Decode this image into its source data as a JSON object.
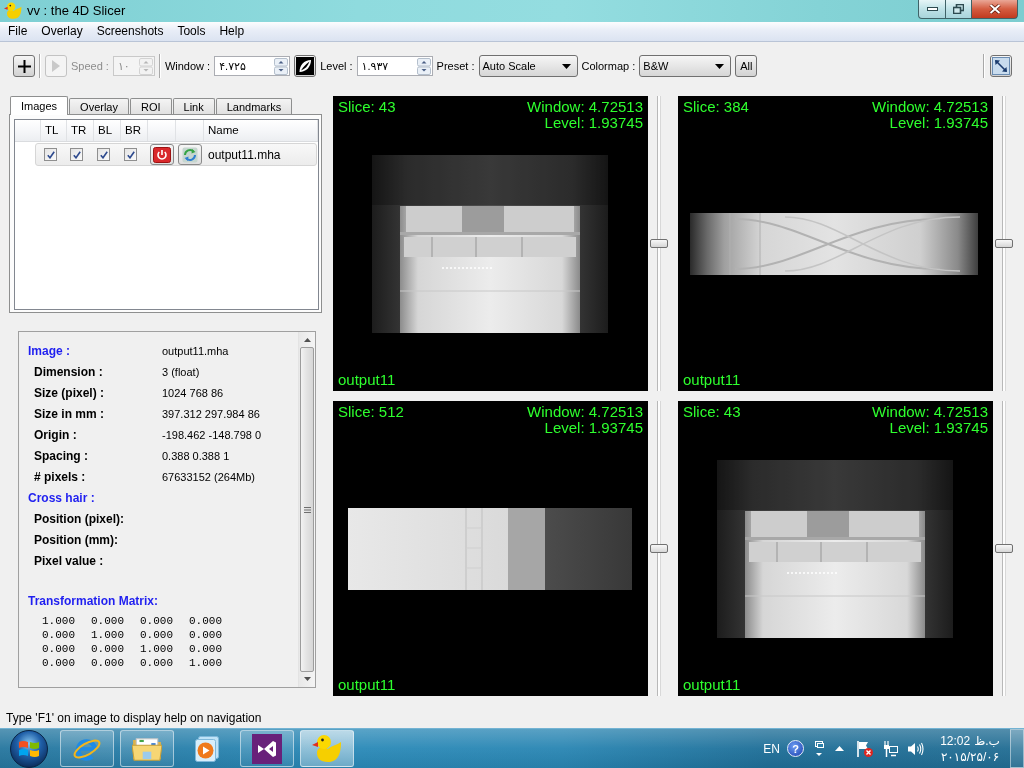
{
  "window": {
    "title": "vv : the 4D Slicer"
  },
  "menu": [
    "File",
    "Overlay",
    "Screenshots",
    "Tools",
    "Help"
  ],
  "toolbar": {
    "play": {
      "disabled": true
    },
    "speed": {
      "label": "Speed :",
      "value": "۱۰",
      "disabled": true
    },
    "window": {
      "label": "Window :",
      "value": "۴.۷۲۵"
    },
    "level": {
      "label": "Level :",
      "value": "۱.۹۳۷"
    },
    "preset": {
      "label": "Preset :",
      "value": "Auto Scale"
    },
    "colormap": {
      "label": "Colormap :",
      "value": "B&W"
    },
    "all_button": "All"
  },
  "tabs": [
    {
      "label": "Images",
      "selected": true
    },
    {
      "label": "Overlay",
      "selected": false
    },
    {
      "label": "ROI",
      "selected": false
    },
    {
      "label": "Link",
      "selected": false
    },
    {
      "label": "Landmarks",
      "selected": false
    }
  ],
  "images_table": {
    "columns": [
      "TL",
      "TR",
      "BL",
      "BR",
      "Name"
    ],
    "rows": [
      {
        "checked": [
          true,
          true,
          true,
          true
        ],
        "name": "output11.mha",
        "selected": true
      }
    ]
  },
  "info": {
    "sections": [
      {
        "title": "Image :",
        "value": "output11.mha",
        "fields": [
          {
            "label": "Dimension :",
            "value": "3 (float)"
          },
          {
            "label": "Size (pixel) :",
            "value": "1024 768 86"
          },
          {
            "label": "Size in mm :",
            "value": "397.312 297.984 86"
          },
          {
            "label": "Origin :",
            "value": "-198.462 -148.798 0"
          },
          {
            "label": "Spacing :",
            "value": "0.388 0.388 1"
          },
          {
            "label": "# pixels :",
            "value": "67633152 (264Mb)"
          }
        ]
      },
      {
        "title": "Cross hair :",
        "fields": [
          {
            "label": "Position (pixel):"
          },
          {
            "label": "Position (mm):"
          },
          {
            "label": "Pixel value :"
          }
        ]
      },
      {
        "title": "Transformation Matrix:",
        "matrix": [
          [
            "1.000",
            "0.000",
            "0.000",
            "0.000"
          ],
          [
            "0.000",
            "1.000",
            "0.000",
            "0.000"
          ],
          [
            "0.000",
            "0.000",
            "1.000",
            "0.000"
          ],
          [
            "0.000",
            "0.000",
            "0.000",
            "1.000"
          ]
        ]
      }
    ]
  },
  "views": [
    {
      "kind": "block",
      "slice": "Slice: 43",
      "window": "Window: 4.72513",
      "level_reading": "Level: 1.93745",
      "image_name": "output11",
      "slider": {
        "level": 0.5
      }
    },
    {
      "kind": "band",
      "slice": "Slice: 384",
      "window": "Window: 4.72513",
      "level_reading": "Level: 1.93745",
      "image_name": "output11",
      "slider": {
        "level": 0.5
      }
    },
    {
      "kind": "strip",
      "slice": "Slice: 512",
      "window": "Window: 4.72513",
      "level_reading": "Level: 1.93745",
      "image_name": "output11",
      "slider": {
        "level": 0.5
      }
    },
    {
      "kind": "block",
      "slice": "Slice: 43",
      "window": "Window: 4.72513",
      "level_reading": "Level: 1.93745",
      "image_name": "output11",
      "slider": {
        "level": 0.5
      }
    }
  ],
  "status_bar": "Type 'F1' on image to display help on navigation",
  "taskbar": {
    "apps": [
      {
        "running": true,
        "selected": false
      },
      {
        "running": true,
        "selected": false
      },
      {
        "running": false,
        "selected": false
      },
      {
        "running": true,
        "selected": false
      },
      {
        "running": true,
        "selected": true
      }
    ],
    "language": "EN",
    "help": "?",
    "time": "12:02",
    "period": "ب.ظ",
    "date": "۲۰۱۵/۲۵/۰۶"
  }
}
